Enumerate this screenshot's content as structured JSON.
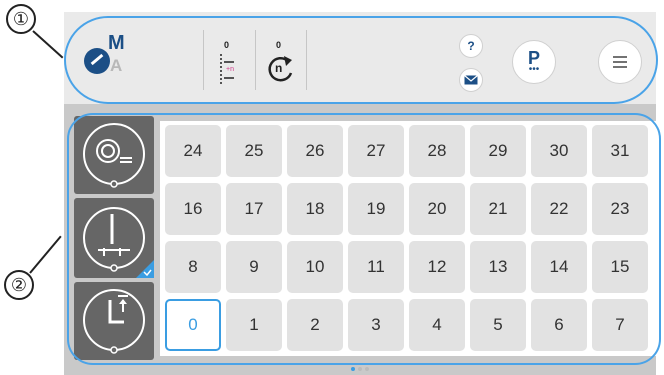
{
  "callouts": [
    "①",
    "②"
  ],
  "header": {
    "mode_primary": "M",
    "mode_secondary": "A",
    "counter_a_value": "0",
    "counter_a_tag": "+n",
    "counter_b_value": "0",
    "counter_b_glyph": "n",
    "help_label": "?",
    "program_label": "P"
  },
  "grid": {
    "rows": [
      [
        "24",
        "25",
        "26",
        "27",
        "28",
        "29",
        "30",
        "31"
      ],
      [
        "16",
        "17",
        "18",
        "19",
        "20",
        "21",
        "22",
        "23"
      ],
      [
        "8",
        "9",
        "10",
        "11",
        "12",
        "13",
        "14",
        "15"
      ],
      [
        "0",
        "1",
        "2",
        "3",
        "4",
        "5",
        "6",
        "7"
      ]
    ],
    "selected": "0"
  },
  "colors": {
    "accent": "#3a9de2",
    "brand": "#1c4f86",
    "panel": "#c9c9c9"
  }
}
